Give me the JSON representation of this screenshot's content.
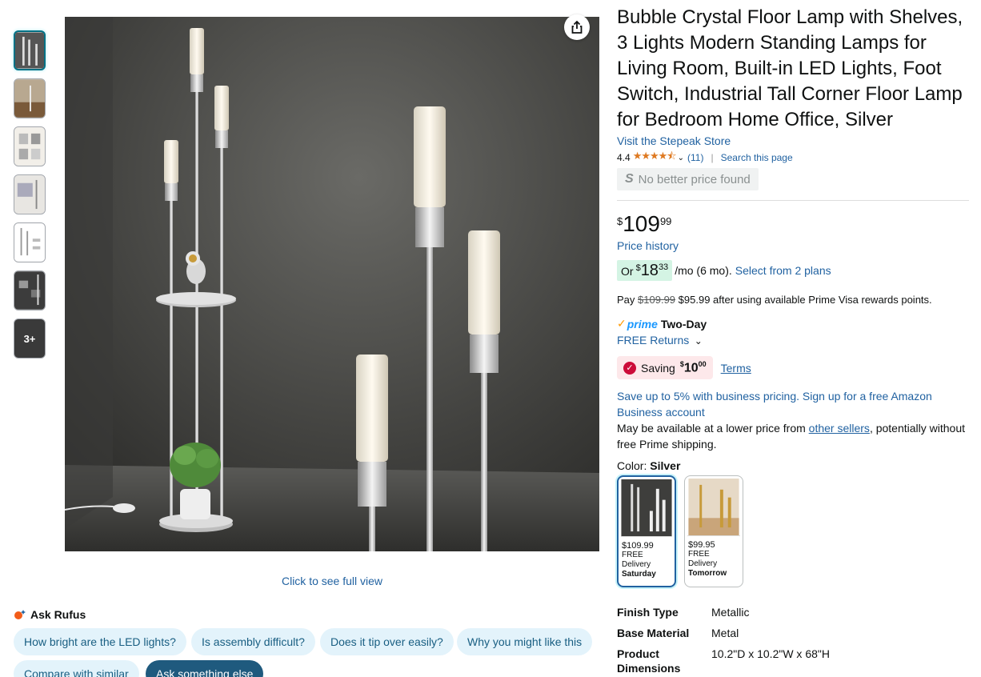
{
  "gallery": {
    "thumbnail_count": 6,
    "more_label": "3+",
    "full_view_link": "Click to see full view"
  },
  "rufus": {
    "title": "Ask Rufus",
    "chips": [
      "How bright are the LED lights?",
      "Is assembly difficult?",
      "Does it tip over easily?",
      "Why you might like this",
      "Compare with similar",
      "Ask something else"
    ]
  },
  "product": {
    "title": "Bubble Crystal Floor Lamp with Shelves, 3 Lights Modern Standing Lamps for Living Room, Built-in LED Lights, Foot Switch, Industrial Tall Corner Floor Lamp for Bedroom Home Office, Silver",
    "store_link": "Visit the Stepeak Store",
    "rating": "4.4",
    "stars": "★★★★⯪",
    "review_count": "(11)",
    "search_page": "Search this page",
    "no_better_price": "No better price found"
  },
  "price": {
    "symbol": "$",
    "whole": "109",
    "fraction": "99",
    "history_link": "Price history",
    "installment_prefix": "Or",
    "installment_symbol": "$",
    "installment_whole": "18",
    "installment_fraction": "33",
    "installment_suffix": "/mo (6 mo).",
    "plans_link": "Select from 2 plans",
    "pay_prefix": "Pay",
    "pay_original": "$109.99",
    "pay_rest": "$95.99 after using available Prime Visa rewards points."
  },
  "delivery": {
    "prime_label": "prime",
    "prime_speed": "Two-Day",
    "returns": "FREE Returns"
  },
  "saving": {
    "label": "Saving",
    "symbol": "$",
    "amount": "10",
    "amount_fraction": "00",
    "terms": "Terms"
  },
  "business": "Save up to 5% with business pricing. Sign up for a free Amazon Business account",
  "lower_price": {
    "prefix": "May be available at a lower price from",
    "link": "other sellers",
    "suffix": ", potentially without free Prime shipping."
  },
  "color": {
    "label": "Color:",
    "selected": "Silver",
    "options": [
      {
        "price": "$109.99",
        "delivery": "FREE Delivery",
        "when": "Saturday"
      },
      {
        "price": "$99.95",
        "delivery": "FREE Delivery",
        "when": "Tomorrow"
      }
    ]
  },
  "specs": [
    {
      "key": "Finish Type",
      "value": "Metallic"
    },
    {
      "key": "Base Material",
      "value": "Metal"
    },
    {
      "key": "Product Dimensions",
      "value": "10.2\"D x 10.2\"W x 68\"H"
    }
  ]
}
